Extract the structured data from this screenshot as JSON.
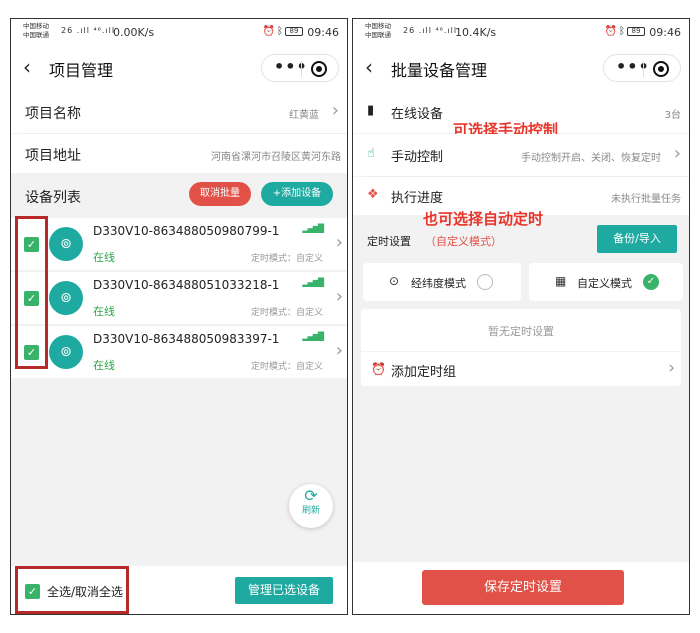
{
  "left": {
    "status_bar": {
      "carrier_line1": "中国移动",
      "carrier_line2": "中国联通",
      "signal": "26 .ıll ⁴⁶.ıll",
      "speed": "0.00K/s",
      "battery": "89",
      "time": "09:46"
    },
    "nav": {
      "back": "‹",
      "title": "项目管理"
    },
    "project": {
      "name_label": "项目名称",
      "name_value": "红黄蓝",
      "address_label": "项目地址",
      "address_value": "河南省漯河市召陵区黄河东路"
    },
    "device_list": {
      "label": "设备列表",
      "cancel_batch": "取消批量",
      "add_device": "+添加设备",
      "items": [
        {
          "name": "D330V10-863488050980799-1",
          "status": "在线",
          "mode": "定时模式：自定义"
        },
        {
          "name": "D330V10-863488051033218-1",
          "status": "在线",
          "mode": "定时模式：自定义"
        },
        {
          "name": "D330V10-863488050983397-1",
          "status": "在线",
          "mode": "定时模式：自定义"
        }
      ]
    },
    "refresh_label": "刷新",
    "select_all": "全选/取消全选",
    "manage_selected": "管理已选设备"
  },
  "right": {
    "status_bar": {
      "carrier_line1": "中国移动",
      "carrier_line2": "中国联通",
      "signal": "26 .ıll ⁴⁶.ıll",
      "speed": "10.4K/s",
      "battery": "89",
      "time": "09:46"
    },
    "nav": {
      "back": "‹",
      "title": "批量设备管理"
    },
    "online": {
      "label": "在线设备",
      "value": "3台"
    },
    "manual": {
      "label": "手动控制",
      "value": "手动控制开启、关闭、恢复定时"
    },
    "progress": {
      "label": "执行进度",
      "value": "未执行批量任务"
    },
    "annotation_manual": "可选择手动控制",
    "annotation_auto": "也可选择自动定时",
    "schedule": {
      "label": "定时设置",
      "sub_label": "（自定义模式）",
      "backup_button": "备份/导入",
      "mode_latlng": "经纬度模式",
      "mode_custom": "自定义模式",
      "empty_text": "暂无定时设置",
      "add_group": "添加定时组"
    },
    "save_button": "保存定时设置"
  },
  "colors": {
    "teal": "#1eaaa0",
    "red": "#e25148",
    "green": "#39b36a",
    "annotation_red": "#e8352c"
  }
}
